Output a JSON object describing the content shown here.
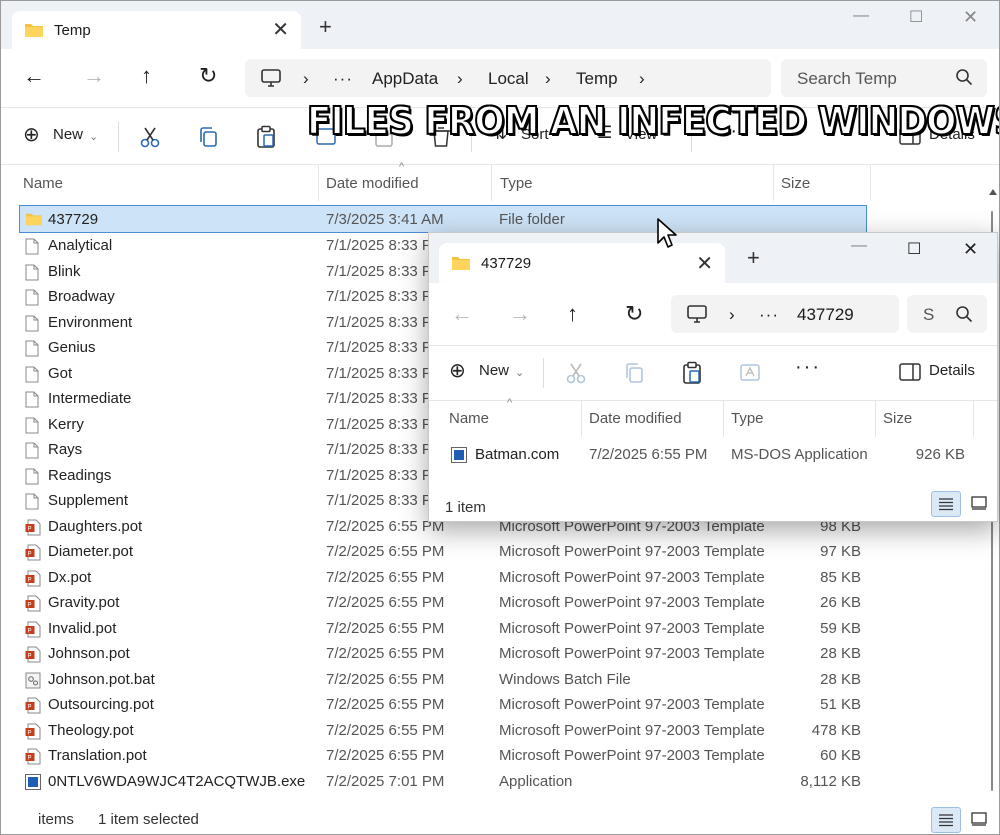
{
  "banner": "FILES FROM AN INFECTED WINDOWS HOST",
  "main": {
    "tab_title": "Temp",
    "breadcrumb": [
      "AppData",
      "Local",
      "Temp"
    ],
    "search_placeholder": "Search Temp",
    "toolbar": {
      "new": "New",
      "sort": "Sort",
      "view": "View",
      "details": "Details"
    },
    "columns": {
      "name": "Name",
      "date": "Date modified",
      "type": "Type",
      "size": "Size"
    },
    "rows": [
      {
        "name": "437729",
        "date": "7/3/2025 3:41 AM",
        "type": "File folder",
        "size": "",
        "icon": "folder-icon"
      },
      {
        "name": "Analytical",
        "date": "7/1/2025 8:33 PM",
        "type": "",
        "size": "",
        "icon": "file-icon"
      },
      {
        "name": "Blink",
        "date": "7/1/2025 8:33 PM",
        "type": "",
        "size": "",
        "icon": "file-icon"
      },
      {
        "name": "Broadway",
        "date": "7/1/2025 8:33 PM",
        "type": "",
        "size": "",
        "icon": "file-icon"
      },
      {
        "name": "Environment",
        "date": "7/1/2025 8:33 PM",
        "type": "",
        "size": "",
        "icon": "file-icon"
      },
      {
        "name": "Genius",
        "date": "7/1/2025 8:33 PM",
        "type": "",
        "size": "",
        "icon": "file-icon"
      },
      {
        "name": "Got",
        "date": "7/1/2025 8:33 PM",
        "type": "",
        "size": "",
        "icon": "file-icon"
      },
      {
        "name": "Intermediate",
        "date": "7/1/2025 8:33 PM",
        "type": "",
        "size": "",
        "icon": "file-icon"
      },
      {
        "name": "Kerry",
        "date": "7/1/2025 8:33 PM",
        "type": "",
        "size": "",
        "icon": "file-icon"
      },
      {
        "name": "Rays",
        "date": "7/1/2025 8:33 PM",
        "type": "",
        "size": "",
        "icon": "file-icon"
      },
      {
        "name": "Readings",
        "date": "7/1/2025 8:33 PM",
        "type": "",
        "size": "",
        "icon": "file-icon"
      },
      {
        "name": "Supplement",
        "date": "7/1/2025 8:33 PM",
        "type": "",
        "size": "",
        "icon": "file-icon"
      },
      {
        "name": "Daughters.pot",
        "date": "7/2/2025 6:55 PM",
        "type": "Microsoft PowerPoint 97-2003 Template",
        "size": "98 KB",
        "icon": "powerpoint-icon"
      },
      {
        "name": "Diameter.pot",
        "date": "7/2/2025 6:55 PM",
        "type": "Microsoft PowerPoint 97-2003 Template",
        "size": "97 KB",
        "icon": "powerpoint-icon"
      },
      {
        "name": "Dx.pot",
        "date": "7/2/2025 6:55 PM",
        "type": "Microsoft PowerPoint 97-2003 Template",
        "size": "85 KB",
        "icon": "powerpoint-icon"
      },
      {
        "name": "Gravity.pot",
        "date": "7/2/2025 6:55 PM",
        "type": "Microsoft PowerPoint 97-2003 Template",
        "size": "26 KB",
        "icon": "powerpoint-icon"
      },
      {
        "name": "Invalid.pot",
        "date": "7/2/2025 6:55 PM",
        "type": "Microsoft PowerPoint 97-2003 Template",
        "size": "59 KB",
        "icon": "powerpoint-icon"
      },
      {
        "name": "Johnson.pot",
        "date": "7/2/2025 6:55 PM",
        "type": "Microsoft PowerPoint 97-2003 Template",
        "size": "28 KB",
        "icon": "powerpoint-icon"
      },
      {
        "name": "Johnson.pot.bat",
        "date": "7/2/2025 6:55 PM",
        "type": "Windows Batch File",
        "size": "28 KB",
        "icon": "batch-file-icon"
      },
      {
        "name": "Outsourcing.pot",
        "date": "7/2/2025 6:55 PM",
        "type": "Microsoft PowerPoint 97-2003 Template",
        "size": "51 KB",
        "icon": "powerpoint-icon"
      },
      {
        "name": "Theology.pot",
        "date": "7/2/2025 6:55 PM",
        "type": "Microsoft PowerPoint 97-2003 Template",
        "size": "478 KB",
        "icon": "powerpoint-icon"
      },
      {
        "name": "Translation.pot",
        "date": "7/2/2025 6:55 PM",
        "type": "Microsoft PowerPoint 97-2003 Template",
        "size": "60 KB",
        "icon": "powerpoint-icon"
      },
      {
        "name": "0NTLV6WDA9WJC4T2ACQTWJB.exe",
        "date": "7/2/2025 7:01 PM",
        "type": "Application",
        "size": "8,112 KB",
        "icon": "application-icon"
      }
    ],
    "status": {
      "items": "items",
      "selected": "1 item selected"
    }
  },
  "popup": {
    "tab_title": "437729",
    "breadcrumb": "437729",
    "search_fragment": "S",
    "toolbar": {
      "new": "New",
      "details": "Details"
    },
    "columns": {
      "name": "Name",
      "date": "Date modified",
      "type": "Type",
      "size": "Size"
    },
    "row": {
      "name": "Batman.com",
      "date": "7/2/2025 6:55 PM",
      "type": "MS-DOS Application",
      "size": "926 KB"
    },
    "status": "1 item"
  }
}
